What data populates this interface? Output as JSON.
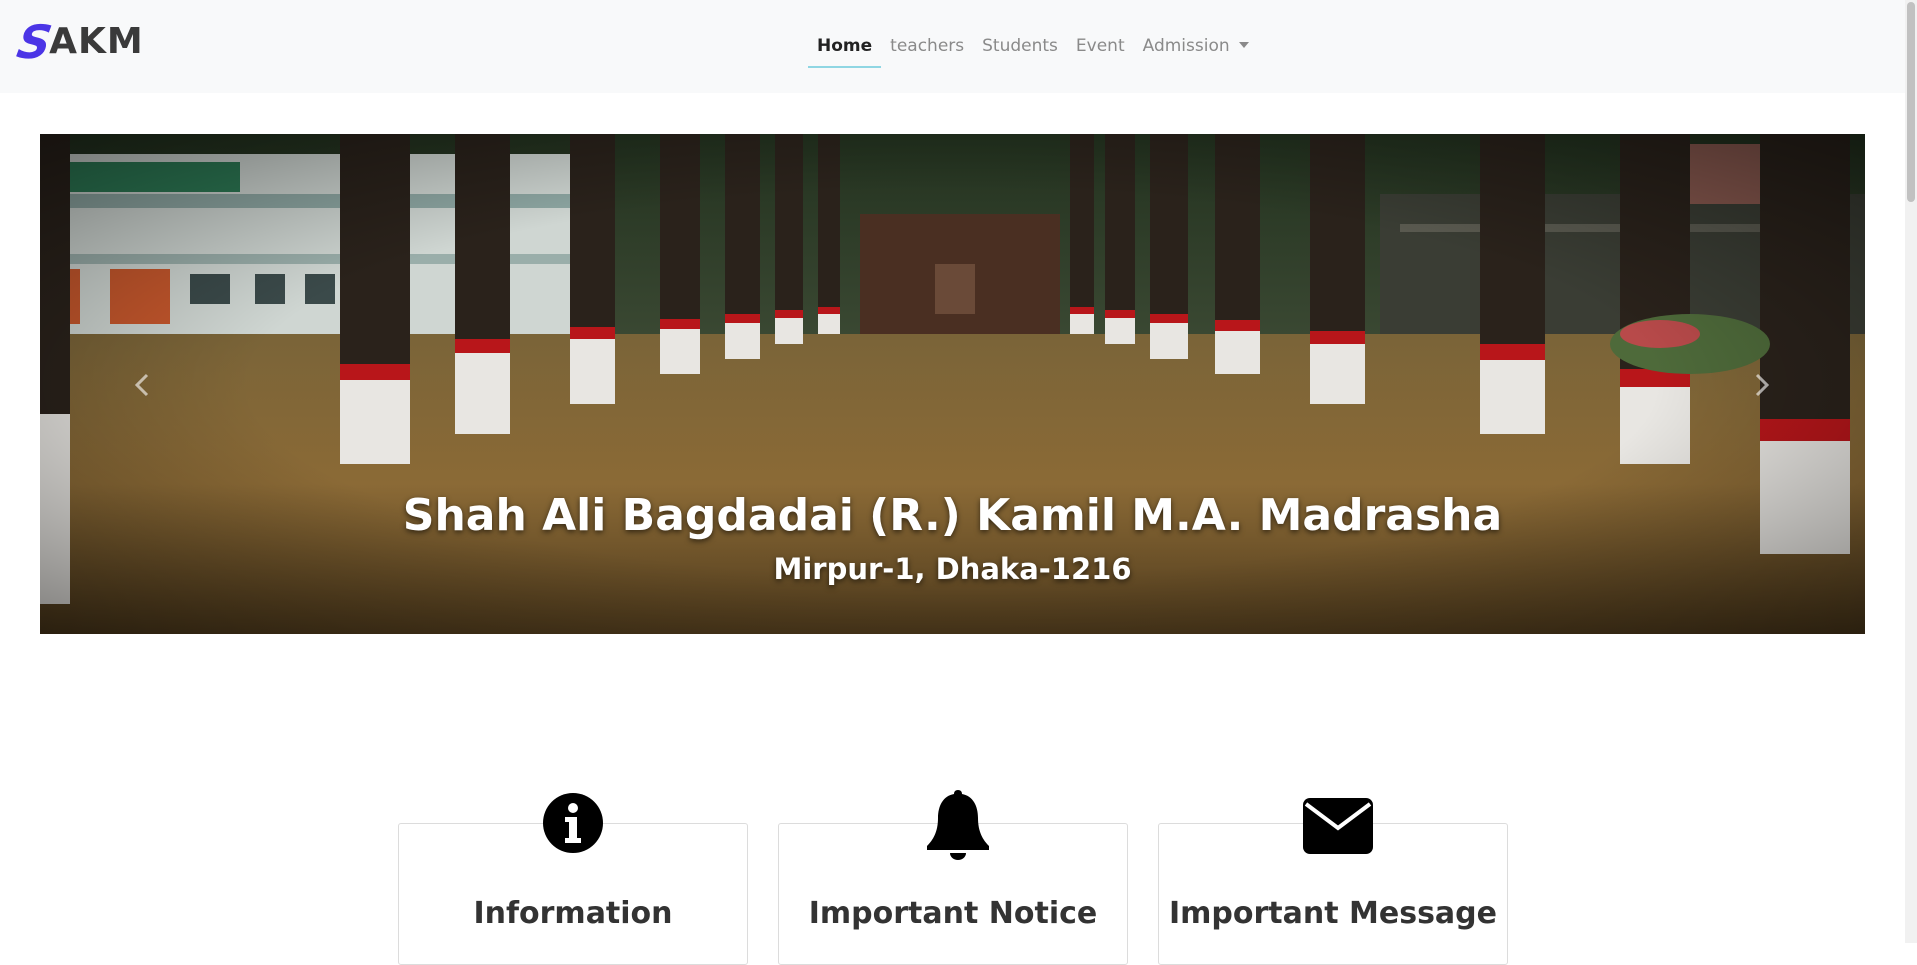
{
  "brand": {
    "initial": "S",
    "rest": "AKM",
    "accent_color": "#4b35e6"
  },
  "nav": {
    "items": [
      {
        "label": "Home",
        "active": true
      },
      {
        "label": "teachers"
      },
      {
        "label": "Students"
      },
      {
        "label": "Event"
      },
      {
        "label": "Admission",
        "dropdown": true
      }
    ],
    "active_underline_color": "#8fd6e3"
  },
  "carousel": {
    "title": "Shah Ali Bagdadai (R.) Kamil M.A. Madrasha",
    "subtitle": "Mirpur-1, Dhaka-1216",
    "controls": {
      "prev_icon": "chevron-left-icon",
      "next_icon": "chevron-right-icon"
    }
  },
  "cards": [
    {
      "title": "Information",
      "icon": "info-circle-icon"
    },
    {
      "title": "Important Notice",
      "icon": "bell-icon"
    },
    {
      "title": "Important Message",
      "icon": "envelope-icon"
    }
  ]
}
